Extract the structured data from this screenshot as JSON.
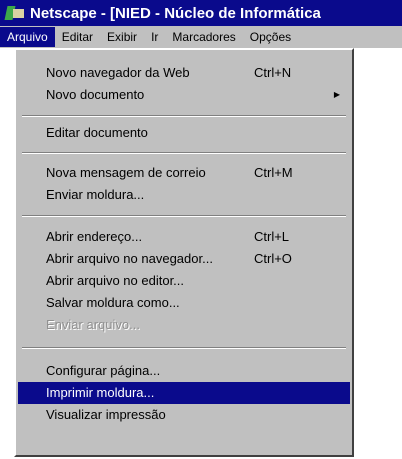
{
  "window": {
    "title": "Netscape - [NIED - Núcleo de Informática"
  },
  "menubar": {
    "items": [
      "Arquivo",
      "Editar",
      "Exibir",
      "Ir",
      "Marcadores",
      "Opções"
    ]
  },
  "file_menu": {
    "items": [
      {
        "label": "Novo navegador da Web",
        "shortcut": "Ctrl+N"
      },
      {
        "label": "Novo documento",
        "submenu_arrow": "▶"
      },
      {
        "label": "Editar documento"
      },
      {
        "label": "Nova mensagem de correio",
        "shortcut": "Ctrl+M"
      },
      {
        "label": "Enviar moldura..."
      },
      {
        "label": "Abrir endereço...",
        "shortcut": "Ctrl+L"
      },
      {
        "label": "Abrir arquivo no navegador...",
        "shortcut": "Ctrl+O"
      },
      {
        "label": "Abrir arquivo no editor..."
      },
      {
        "label": "Salvar moldura como..."
      },
      {
        "label": "Enviar arquivo...",
        "state": "disabled"
      },
      {
        "label": "Configurar página..."
      },
      {
        "label": "Imprimir moldura...",
        "state": "highlighted"
      },
      {
        "label": "Visualizar impressão"
      }
    ]
  },
  "colors": {
    "title_bar": "#0a0a8c",
    "menu_face": "#c0c0c0",
    "highlight": "#0a0a8c",
    "disabled_text": "#8f8f8f"
  }
}
